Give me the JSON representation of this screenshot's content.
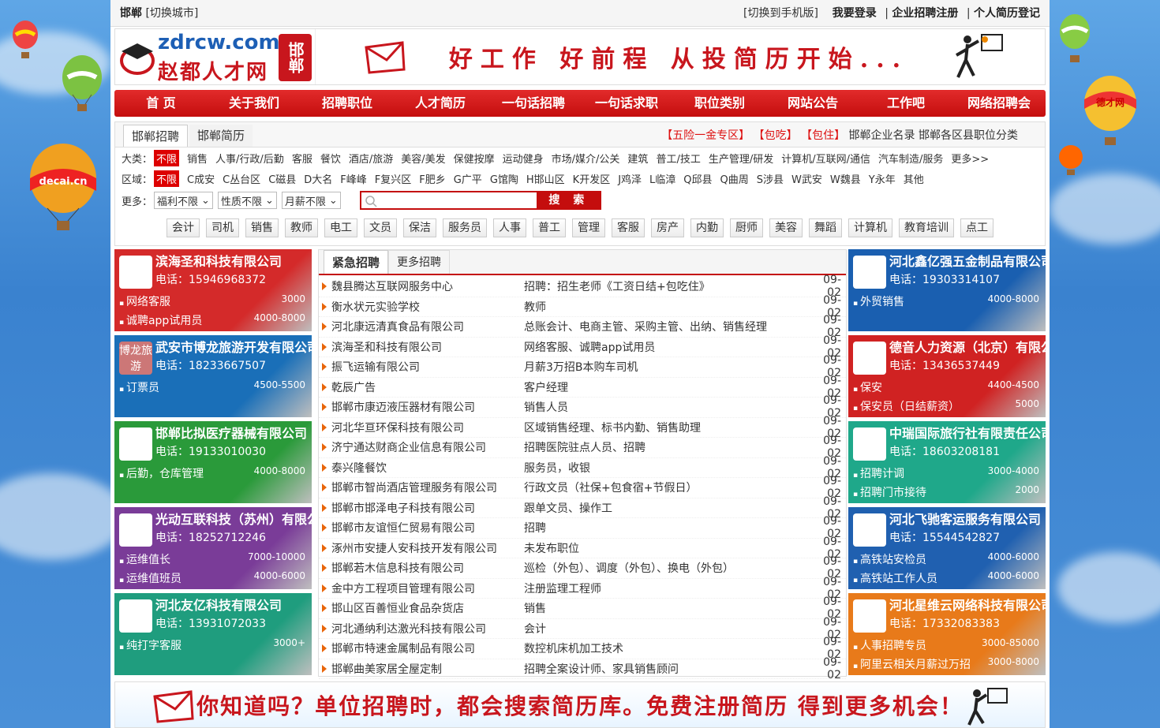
{
  "top": {
    "city": "邯郸",
    "switch_city": "[切换城市]",
    "mobile": "[切换到手机版]",
    "login": "我要登录",
    "sep": "|",
    "company_reg": "企业招聘注册",
    "resume_reg": "个人简历登记"
  },
  "logo": {
    "domain": "zdrcw.com",
    "name": "赵都人才网",
    "seal": "邯郸"
  },
  "slogan": "好工作 好前程 从投简历开始...",
  "nav": [
    "首 页",
    "关于我们",
    "招聘职位",
    "人才简历",
    "一句话招聘",
    "一句话求职",
    "职位类别",
    "网站公告",
    "工作吧",
    "网络招聘会"
  ],
  "filter": {
    "tabs": [
      "邯郸招聘",
      "邯郸简历"
    ],
    "links": [
      "【五险一金专区】",
      "【包吃】",
      "【包住】",
      "邯郸企业名录",
      "邯郸各区县职位分类"
    ],
    "cat_label": "大类：",
    "cat_all": "不限",
    "cats": [
      "销售",
      "人事/行政/后勤",
      "客服",
      "餐饮",
      "酒店/旅游",
      "美容/美发",
      "保健按摩",
      "运动健身",
      "市场/媒介/公关",
      "建筑",
      "普工/技工",
      "生产管理/研发",
      "计算机/互联网/通信",
      "汽车制造/服务",
      "更多>>"
    ],
    "area_label": "区域：",
    "area_all": "不限",
    "areas": [
      "C成安",
      "C丛台区",
      "C磁县",
      "D大名",
      "F峰峰",
      "F复兴区",
      "F肥乡",
      "G广平",
      "G馆陶",
      "H邯山区",
      "K开发区",
      "J鸡泽",
      "L临漳",
      "Q邱县",
      "Q曲周",
      "S涉县",
      "W武安",
      "W魏县",
      "Y永年",
      "其他"
    ],
    "more_label": "更多：",
    "selects": [
      "福利不限",
      "性质不限",
      "月薪不限"
    ],
    "search_btn": "搜 索",
    "tags": [
      "会计",
      "司机",
      "销售",
      "教师",
      "电工",
      "文员",
      "保洁",
      "服务员",
      "人事",
      "普工",
      "管理",
      "客服",
      "房产",
      "内勤",
      "厨师",
      "美容",
      "舞蹈",
      "计算机",
      "教育培训",
      "点工"
    ]
  },
  "left": [
    {
      "name": "滨海圣和科技有限公司",
      "phone": "电话：15946968372",
      "color": "#d42a2a",
      "jobs": [
        [
          "网络客服",
          "3000"
        ],
        [
          "诚聘app试用员",
          "4000-8000"
        ]
      ]
    },
    {
      "name": "武安市博龙旅游开发有限公司",
      "phone": "电话：18233667507",
      "color": "#1a6fb8",
      "icon": "博龙旅游",
      "jobs": [
        [
          "订票员",
          "4500-5500"
        ]
      ]
    },
    {
      "name": "邯郸比拟医疗器械有限公司",
      "phone": "电话：19133010030",
      "color": "#2a9a3a",
      "jobs": [
        [
          "后勤，仓库管理",
          "4000-8000"
        ]
      ]
    },
    {
      "name": "光动互联科技（苏州）有限公司",
      "phone": "电话：18252712246",
      "color": "#7a3c98",
      "jobs": [
        [
          "运维值长",
          "7000-10000"
        ],
        [
          "运维值班员",
          "4000-6000"
        ]
      ]
    },
    {
      "name": "河北友亿科技有限公司",
      "phone": "电话：13931072033",
      "color": "#1f9d7e",
      "jobs": [
        [
          "纯打字客服",
          "3000+"
        ]
      ]
    }
  ],
  "right": [
    {
      "name": "河北鑫亿强五金制品有限公司",
      "phone": "电话：19303314107",
      "color": "#1a5fb0",
      "jobs": [
        [
          "外贸销售",
          "4000-8000"
        ]
      ]
    },
    {
      "name": "德音人力资源（北京）有限公司",
      "phone": "电话：13436537449",
      "color": "#d02222",
      "jobs": [
        [
          "保安",
          "4400-4500"
        ],
        [
          "保安员（日结薪资）",
          "5000"
        ]
      ]
    },
    {
      "name": "中瑞国际旅行社有限责任公司",
      "phone": "电话：18603208181",
      "color": "#1fa88a",
      "jobs": [
        [
          "招聘计调",
          "3000-4000"
        ],
        [
          "招聘门市接待",
          "2000"
        ]
      ]
    },
    {
      "name": "河北飞驰客运服务有限公司",
      "phone": "电话：15544542827",
      "color": "#2060b0",
      "jobs": [
        [
          "高铁站安检员",
          "4000-6000"
        ],
        [
          "高铁站工作人员",
          "4000-6000"
        ]
      ]
    },
    {
      "name": "河北星维云网络科技有限公司",
      "phone": "电话：17332083383",
      "color": "#e87a1a",
      "jobs": [
        [
          "人事招聘专员",
          "3000-85000"
        ],
        [
          "阿里云相关月薪过万招",
          "3000-8000"
        ]
      ]
    }
  ],
  "middle": {
    "tabs": [
      "紧急招聘",
      "更多招聘"
    ],
    "rows": [
      [
        "魏县腾达互联网服务中心",
        "招聘：招生老师《工资日结+包吃住》",
        "09-02"
      ],
      [
        "衡水状元实验学校",
        "教师",
        "09-02"
      ],
      [
        "河北康远清真食品有限公司",
        "总账会计、电商主管、采购主管、出纳、销售经理",
        "09-02"
      ],
      [
        "滨海圣和科技有限公司",
        "网络客服、诚聘app试用员",
        "09-02"
      ],
      [
        "振飞运输有限公司",
        "月薪3万招B本购车司机",
        "09-02"
      ],
      [
        "乾辰广告",
        "客户经理",
        "09-02"
      ],
      [
        "邯郸市康迈液压器材有限公司",
        "销售人员",
        "09-02"
      ],
      [
        "河北华亘环保科技有限公司",
        "区域销售经理、标书内勤、销售助理",
        "09-02"
      ],
      [
        "济宁通达财商企业信息有限公司",
        "招聘医院驻点人员、招聘",
        "09-02"
      ],
      [
        "泰兴隆餐饮",
        "服务员，收银",
        "09-02"
      ],
      [
        "邯郸市智尚酒店管理服务有限公司",
        "行政文员（社保+包食宿+节假日）",
        "09-02"
      ],
      [
        "邯郸市邯泽电子科技有限公司",
        "跟单文员、操作工",
        "09-02"
      ],
      [
        "邯郸市友谊恒仁贸易有限公司",
        "招聘",
        "09-02"
      ],
      [
        "涿州市安捷人安科技开发有限公司",
        "未发布职位",
        "09-02"
      ],
      [
        "邯郸若木信息科技有限公司",
        "巡检（外包）、调度（外包）、换电（外包）",
        "09-02"
      ],
      [
        "金中方工程项目管理有限公司",
        "注册监理工程师",
        "09-02"
      ],
      [
        "邯山区百善恒业食品杂货店",
        "销售",
        "09-02"
      ],
      [
        "河北通纳利达激光科技有限公司",
        "会计",
        "09-02"
      ],
      [
        "邯郸市特速金属制品有限公司",
        "数控机床机加工技术",
        "09-02"
      ],
      [
        "邯郸曲美家居全屋定制",
        "招聘全案设计师、家具销售顾问",
        "09-02"
      ]
    ]
  },
  "bottom": "你知道吗？单位招聘时，都会搜索简历库。免费注册简历 得到更多机会！",
  "balloon_texts": [
    "decai.cn",
    "德才网"
  ]
}
